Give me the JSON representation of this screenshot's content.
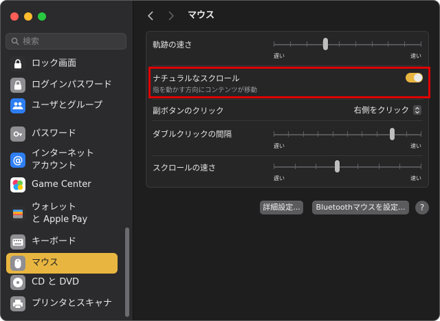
{
  "sidebar": {
    "search_placeholder": "検索",
    "items": [
      {
        "label": "ロック画面",
        "icon": "lock-icon",
        "color": "#2f2f31"
      },
      {
        "label": "ログインパスワード",
        "icon": "lock-icon",
        "color": "#8e8e93"
      },
      {
        "label": "ユーザとグループ",
        "icon": "users-icon",
        "color": "#2e7ef2"
      },
      {
        "label": "パスワード",
        "icon": "key-icon",
        "color": "#8e8e93"
      },
      {
        "label": "インターネット",
        "label2": "アカウント",
        "icon": "at-icon",
        "color": "#2e7ef2"
      },
      {
        "label": "Game Center",
        "icon": "game-center-icon",
        "color": "#ffffff"
      },
      {
        "label": "ウォレット",
        "label2": "と Apple Pay",
        "icon": "wallet-icon",
        "color": "#2f2f31"
      },
      {
        "label": "キーボード",
        "icon": "keyboard-icon",
        "color": "#8e8e93"
      },
      {
        "label": "マウス",
        "icon": "mouse-icon",
        "color": "#8e8e93",
        "selected": true
      },
      {
        "label": "CD と DVD",
        "icon": "disc-icon",
        "color": "#8e8e93"
      },
      {
        "label": "プリンタとスキャナ",
        "icon": "printer-icon",
        "color": "#8e8e93"
      }
    ]
  },
  "header": {
    "title": "マウス"
  },
  "settings": {
    "tracking": {
      "label": "軌跡の速さ",
      "min": "遅い",
      "max": "速い",
      "level": 0.35,
      "ticks": 10
    },
    "natural_scroll": {
      "label": "ナチュラルなスクロール",
      "sublabel": "指を動かす方向にコンテンツが移動",
      "on": true
    },
    "secondary_click": {
      "label": "副ボタンのクリック",
      "value": "右側をクリック"
    },
    "double_click": {
      "label": "ダブルクリックの間隔",
      "min": "遅い",
      "max": "速い",
      "level": 0.8,
      "ticks": 11
    },
    "scroll_speed": {
      "label": "スクロールの速さ",
      "min": "遅い",
      "max": "速い",
      "level": 0.43,
      "ticks": 8
    }
  },
  "buttons": {
    "advanced": "詳細設定...",
    "bluetooth": "Bluetoothマウスを設定...",
    "help": "?"
  },
  "colors": {
    "accent": "#e8b640",
    "highlight": "#e00000"
  }
}
